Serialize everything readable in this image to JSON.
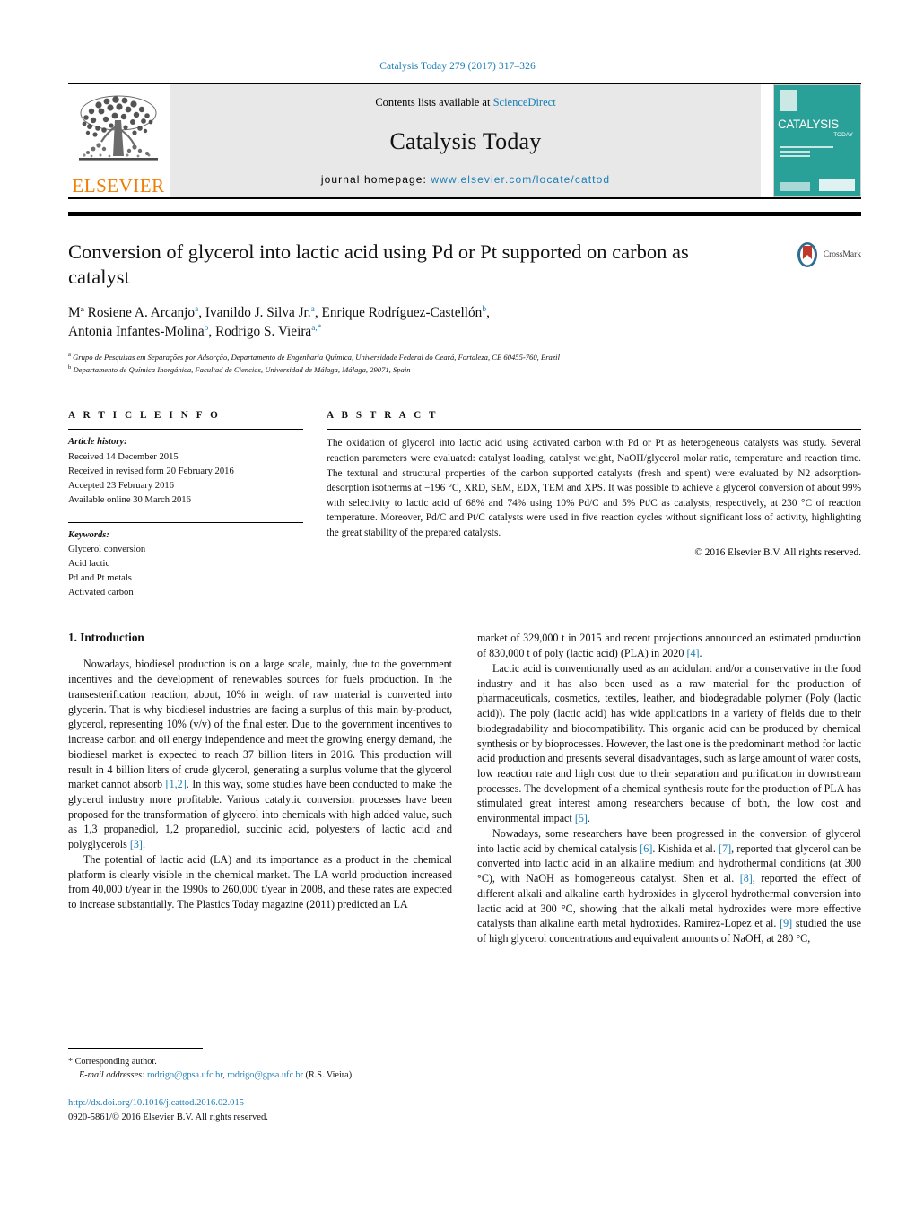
{
  "running_head": "Catalysis Today 279 (2017) 317–326",
  "masthead": {
    "publisher": "ELSEVIER",
    "contents_prefix": "Contents lists available at ",
    "contents_link": "ScienceDirect",
    "journal_name": "Catalysis Today",
    "homepage_prefix": "journal homepage: ",
    "homepage_url": "www.elsevier.com/locate/cattod",
    "cover_title": "CATALYSIS",
    "cover_subtitle": "TODAY",
    "link_color": "#1a7db5",
    "band_color": "#e8e8e8",
    "cover_color": "#2aa198",
    "elsevier_color": "#f07d00"
  },
  "article": {
    "title": "Conversion of glycerol into lactic acid using Pd or Pt supported on carbon as catalyst",
    "crossmark_label": "CrossMark",
    "authors_line1_a": "M",
    "authors_line1": "Rosiene A. Arcanjo",
    "authors": [
      {
        "name": "Mª Rosiene A. Arcanjo",
        "mark": "a"
      },
      {
        "name": "Ivanildo J. Silva Jr.",
        "mark": "a"
      },
      {
        "name": "Enrique Rodríguez-Castellón",
        "mark": "b"
      },
      {
        "name": "Antonia Infantes-Molina",
        "mark": "b"
      },
      {
        "name": "Rodrigo S. Vieira",
        "mark": "a,*"
      }
    ],
    "affiliations": [
      {
        "mark": "a",
        "text": "Grupo de Pesquisas em Separações por Adsorção, Departamento de Engenharia Química, Universidade Federal do Ceará, Fortaleza, CE 60455-760, Brazil"
      },
      {
        "mark": "b",
        "text": "Departamento de Química Inorgánica, Facultad de Ciencias, Universidad de Málaga, Málaga, 29071, Spain"
      }
    ]
  },
  "article_info": {
    "heading": "A R T I C L E   I N F O",
    "history_label": "Article history:",
    "history": [
      "Received 14 December 2015",
      "Received in revised form 20 February 2016",
      "Accepted 23 February 2016",
      "Available online 30 March 2016"
    ],
    "keywords_label": "Keywords:",
    "keywords": [
      "Glycerol conversion",
      "Acid lactic",
      "Pd and Pt metals",
      "Activated carbon"
    ]
  },
  "abstract": {
    "heading": "A B S T R A C T",
    "text": "The oxidation of glycerol into lactic acid using activated carbon with Pd or Pt as heterogeneous catalysts was study. Several reaction parameters were evaluated: catalyst loading, catalyst weight, NaOH/glycerol molar ratio, temperature and reaction time. The textural and structural properties of the carbon supported catalysts (fresh and spent) were evaluated by N2 adsorption-desorption isotherms at −196 °C, XRD, SEM, EDX, TEM and XPS. It was possible to achieve a glycerol conversion of about 99% with selectivity to lactic acid of 68% and 74% using 10% Pd/C and 5% Pt/C as catalysts, respectively, at 230 °C of reaction temperature. Moreover, Pd/C and Pt/C catalysts were used in five reaction cycles without significant loss of activity, highlighting the great stability of the prepared catalysts.",
    "copyright": "© 2016 Elsevier B.V. All rights reserved."
  },
  "body": {
    "section_heading": "1.  Introduction",
    "left_paragraphs": [
      "Nowadays, biodiesel production is on a large scale, mainly, due to the government incentives and the development of renewables sources for fuels production. In the transesterification reaction, about, 10% in weight of raw material is converted into glycerin. That is why biodiesel industries are facing a surplus of this main by-product, glycerol, representing 10% (v/v) of the final ester. Due to the government incentives to increase carbon and oil energy independence and meet the growing energy demand, the biodiesel market is expected to reach 37 billion liters in 2016. This production will result in 4 billion liters of crude glycerol, generating a surplus volume that the glycerol market cannot absorb [1,2]. In this way, some studies have been conducted to make the glycerol industry more profitable. Various catalytic conversion processes have been proposed for the transformation of glycerol into chemicals with high added value, such as 1,3 propanediol, 1,2 propanediol, succinic acid, polyesters of lactic acid and polyglycerols [3].",
      "The potential of lactic acid (LA) and its importance as a product in the chemical platform is clearly visible in the chemical market. The LA world production increased from 40,000 t/year in the 1990s to 260,000 t/year in 2008, and these rates are expected to increase substantially. The Plastics Today magazine (2011) predicted an LA"
    ],
    "right_paragraphs": [
      "market of 329,000 t in 2015 and recent projections announced an estimated production of 830,000 t of poly (lactic acid) (PLA) in 2020 [4].",
      "Lactic acid is conventionally used as an acidulant and/or a conservative in the food industry and it has also been used as a raw material for the production of pharmaceuticals, cosmetics, textiles, leather, and biodegradable polymer (Poly (lactic acid)). The poly (lactic acid) has wide applications in a variety of fields due to their biodegradability and biocompatibility. This organic acid can be produced by chemical synthesis or by bioprocesses. However, the last one is the predominant method for lactic acid production and presents several disadvantages, such as large amount of water costs, low reaction rate and high cost due to their separation and purification in downstream processes. The development of a chemical synthesis route for the production of PLA has stimulated great interest among researchers because of both, the low cost and environmental impact [5].",
      "Nowadays, some researchers have been progressed in the conversion of glycerol into lactic acid by chemical catalysis [6]. Kishida et al. [7], reported that glycerol can be converted into lactic acid in an alkaline medium and hydrothermal conditions (at 300 °C), with NaOH as homogeneous catalyst. Shen et al. [8], reported the effect of different alkali and alkaline earth hydroxides in glycerol hydrothermal conversion into lactic acid at 300 °C, showing that the alkali metal hydroxides were more effective catalysts than alkaline earth metal hydroxides. Ramirez-Lopez et al. [9] studied the use of high glycerol concentrations and equivalent amounts of NaOH, at 280 °C,"
    ]
  },
  "footnote": {
    "corresponding": "*  Corresponding author.",
    "email_label": "E-mail addresses:",
    "email1": "rodrigo@gpsa.ufc.br",
    "email_sep": ", ",
    "email2": "rodrigo@gpsa.ufc.br",
    "email_attrib": " (R.S. Vieira)."
  },
  "bottom": {
    "doi": "http://dx.doi.org/10.1016/j.cattod.2016.02.015",
    "issn_line": "0920-5861/© 2016 Elsevier B.V. All rights reserved."
  }
}
